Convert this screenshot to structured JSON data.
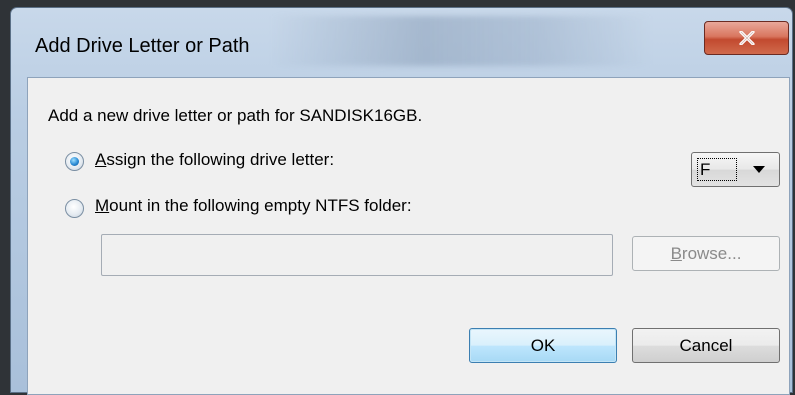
{
  "window": {
    "title": "Add Drive Letter or Path",
    "close_icon": "close-icon"
  },
  "dialog": {
    "description": "Add a new drive letter or path for SANDISK16GB.",
    "option_assign": {
      "mnemonic": "A",
      "rest": "ssign the following drive letter:",
      "selected": true
    },
    "drive_letter": {
      "value": "F",
      "icon": "chevron-down-icon"
    },
    "option_mount": {
      "mnemonic": "M",
      "rest": "ount in the following empty NTFS folder:",
      "selected": false
    },
    "folder_path": {
      "value": "",
      "enabled": false
    },
    "browse_button": {
      "mnemonic": "B",
      "rest": "rowse...",
      "enabled": false
    },
    "ok_label": "OK",
    "cancel_label": "Cancel"
  },
  "colors": {
    "accent_blue": "#3c7fb1",
    "close_red": "#c24a2f",
    "dialog_bg": "#f0f0f0"
  }
}
